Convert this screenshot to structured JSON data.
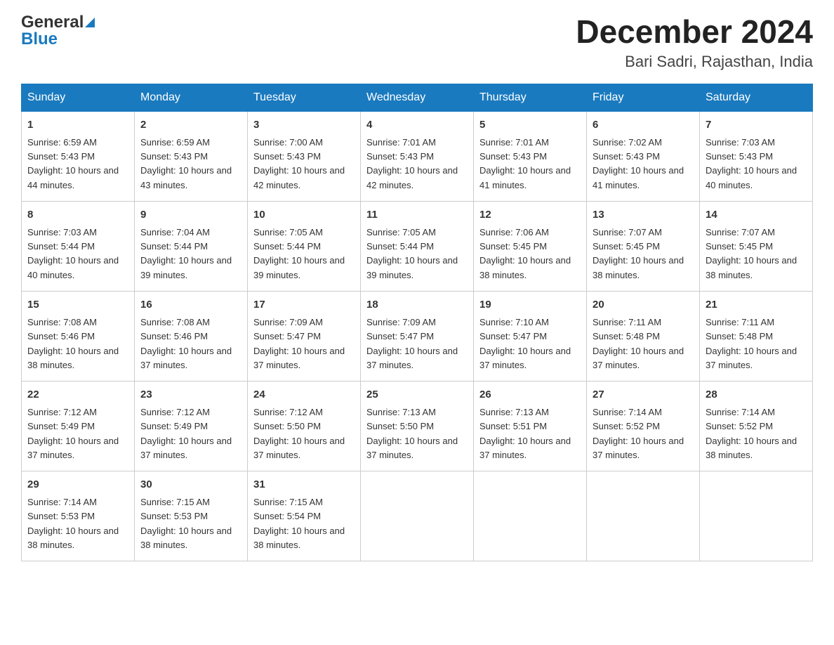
{
  "header": {
    "logo_general": "General",
    "logo_blue": "Blue",
    "month_title": "December 2024",
    "location": "Bari Sadri, Rajasthan, India"
  },
  "days_of_week": [
    "Sunday",
    "Monday",
    "Tuesday",
    "Wednesday",
    "Thursday",
    "Friday",
    "Saturday"
  ],
  "weeks": [
    [
      {
        "day": "1",
        "sunrise": "6:59 AM",
        "sunset": "5:43 PM",
        "daylight": "10 hours and 44 minutes."
      },
      {
        "day": "2",
        "sunrise": "6:59 AM",
        "sunset": "5:43 PM",
        "daylight": "10 hours and 43 minutes."
      },
      {
        "day": "3",
        "sunrise": "7:00 AM",
        "sunset": "5:43 PM",
        "daylight": "10 hours and 42 minutes."
      },
      {
        "day": "4",
        "sunrise": "7:01 AM",
        "sunset": "5:43 PM",
        "daylight": "10 hours and 42 minutes."
      },
      {
        "day": "5",
        "sunrise": "7:01 AM",
        "sunset": "5:43 PM",
        "daylight": "10 hours and 41 minutes."
      },
      {
        "day": "6",
        "sunrise": "7:02 AM",
        "sunset": "5:43 PM",
        "daylight": "10 hours and 41 minutes."
      },
      {
        "day": "7",
        "sunrise": "7:03 AM",
        "sunset": "5:43 PM",
        "daylight": "10 hours and 40 minutes."
      }
    ],
    [
      {
        "day": "8",
        "sunrise": "7:03 AM",
        "sunset": "5:44 PM",
        "daylight": "10 hours and 40 minutes."
      },
      {
        "day": "9",
        "sunrise": "7:04 AM",
        "sunset": "5:44 PM",
        "daylight": "10 hours and 39 minutes."
      },
      {
        "day": "10",
        "sunrise": "7:05 AM",
        "sunset": "5:44 PM",
        "daylight": "10 hours and 39 minutes."
      },
      {
        "day": "11",
        "sunrise": "7:05 AM",
        "sunset": "5:44 PM",
        "daylight": "10 hours and 39 minutes."
      },
      {
        "day": "12",
        "sunrise": "7:06 AM",
        "sunset": "5:45 PM",
        "daylight": "10 hours and 38 minutes."
      },
      {
        "day": "13",
        "sunrise": "7:07 AM",
        "sunset": "5:45 PM",
        "daylight": "10 hours and 38 minutes."
      },
      {
        "day": "14",
        "sunrise": "7:07 AM",
        "sunset": "5:45 PM",
        "daylight": "10 hours and 38 minutes."
      }
    ],
    [
      {
        "day": "15",
        "sunrise": "7:08 AM",
        "sunset": "5:46 PM",
        "daylight": "10 hours and 38 minutes."
      },
      {
        "day": "16",
        "sunrise": "7:08 AM",
        "sunset": "5:46 PM",
        "daylight": "10 hours and 37 minutes."
      },
      {
        "day": "17",
        "sunrise": "7:09 AM",
        "sunset": "5:47 PM",
        "daylight": "10 hours and 37 minutes."
      },
      {
        "day": "18",
        "sunrise": "7:09 AM",
        "sunset": "5:47 PM",
        "daylight": "10 hours and 37 minutes."
      },
      {
        "day": "19",
        "sunrise": "7:10 AM",
        "sunset": "5:47 PM",
        "daylight": "10 hours and 37 minutes."
      },
      {
        "day": "20",
        "sunrise": "7:11 AM",
        "sunset": "5:48 PM",
        "daylight": "10 hours and 37 minutes."
      },
      {
        "day": "21",
        "sunrise": "7:11 AM",
        "sunset": "5:48 PM",
        "daylight": "10 hours and 37 minutes."
      }
    ],
    [
      {
        "day": "22",
        "sunrise": "7:12 AM",
        "sunset": "5:49 PM",
        "daylight": "10 hours and 37 minutes."
      },
      {
        "day": "23",
        "sunrise": "7:12 AM",
        "sunset": "5:49 PM",
        "daylight": "10 hours and 37 minutes."
      },
      {
        "day": "24",
        "sunrise": "7:12 AM",
        "sunset": "5:50 PM",
        "daylight": "10 hours and 37 minutes."
      },
      {
        "day": "25",
        "sunrise": "7:13 AM",
        "sunset": "5:50 PM",
        "daylight": "10 hours and 37 minutes."
      },
      {
        "day": "26",
        "sunrise": "7:13 AM",
        "sunset": "5:51 PM",
        "daylight": "10 hours and 37 minutes."
      },
      {
        "day": "27",
        "sunrise": "7:14 AM",
        "sunset": "5:52 PM",
        "daylight": "10 hours and 37 minutes."
      },
      {
        "day": "28",
        "sunrise": "7:14 AM",
        "sunset": "5:52 PM",
        "daylight": "10 hours and 38 minutes."
      }
    ],
    [
      {
        "day": "29",
        "sunrise": "7:14 AM",
        "sunset": "5:53 PM",
        "daylight": "10 hours and 38 minutes."
      },
      {
        "day": "30",
        "sunrise": "7:15 AM",
        "sunset": "5:53 PM",
        "daylight": "10 hours and 38 minutes."
      },
      {
        "day": "31",
        "sunrise": "7:15 AM",
        "sunset": "5:54 PM",
        "daylight": "10 hours and 38 minutes."
      },
      null,
      null,
      null,
      null
    ]
  ],
  "labels": {
    "sunrise_prefix": "Sunrise: ",
    "sunset_prefix": "Sunset: ",
    "daylight_prefix": "Daylight: "
  }
}
